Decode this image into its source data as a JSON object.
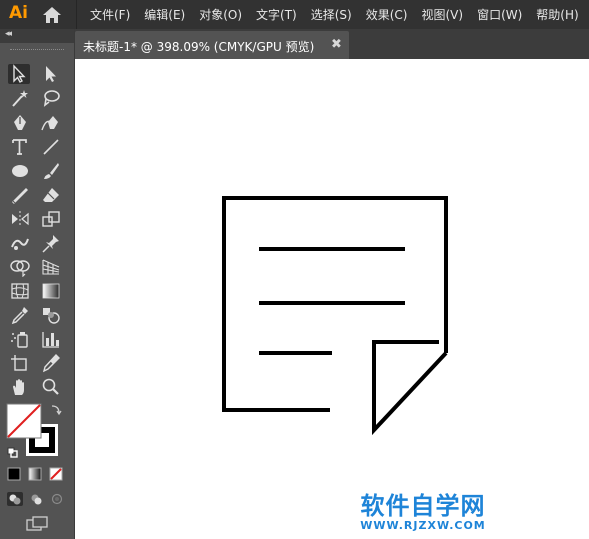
{
  "app": {
    "logo": "Ai"
  },
  "menu": {
    "items": [
      "文件(F)",
      "编辑(E)",
      "对象(O)",
      "文字(T)",
      "选择(S)",
      "效果(C)",
      "视图(V)",
      "窗口(W)",
      "帮助(H)"
    ]
  },
  "tab": {
    "title": "未标题-1* @ 398.09% (CMYK/GPU 预览)",
    "close": "✖"
  },
  "toolbar": {
    "collapse": "◂◂"
  },
  "watermark": {
    "main": "软件自学网",
    "sub": "WWW.RJZXW.COM"
  },
  "colors": {
    "accent": "#ff9a00",
    "watermark": "#1e84d8",
    "canvas": "#ffffff",
    "ui_bg": "#535353"
  }
}
